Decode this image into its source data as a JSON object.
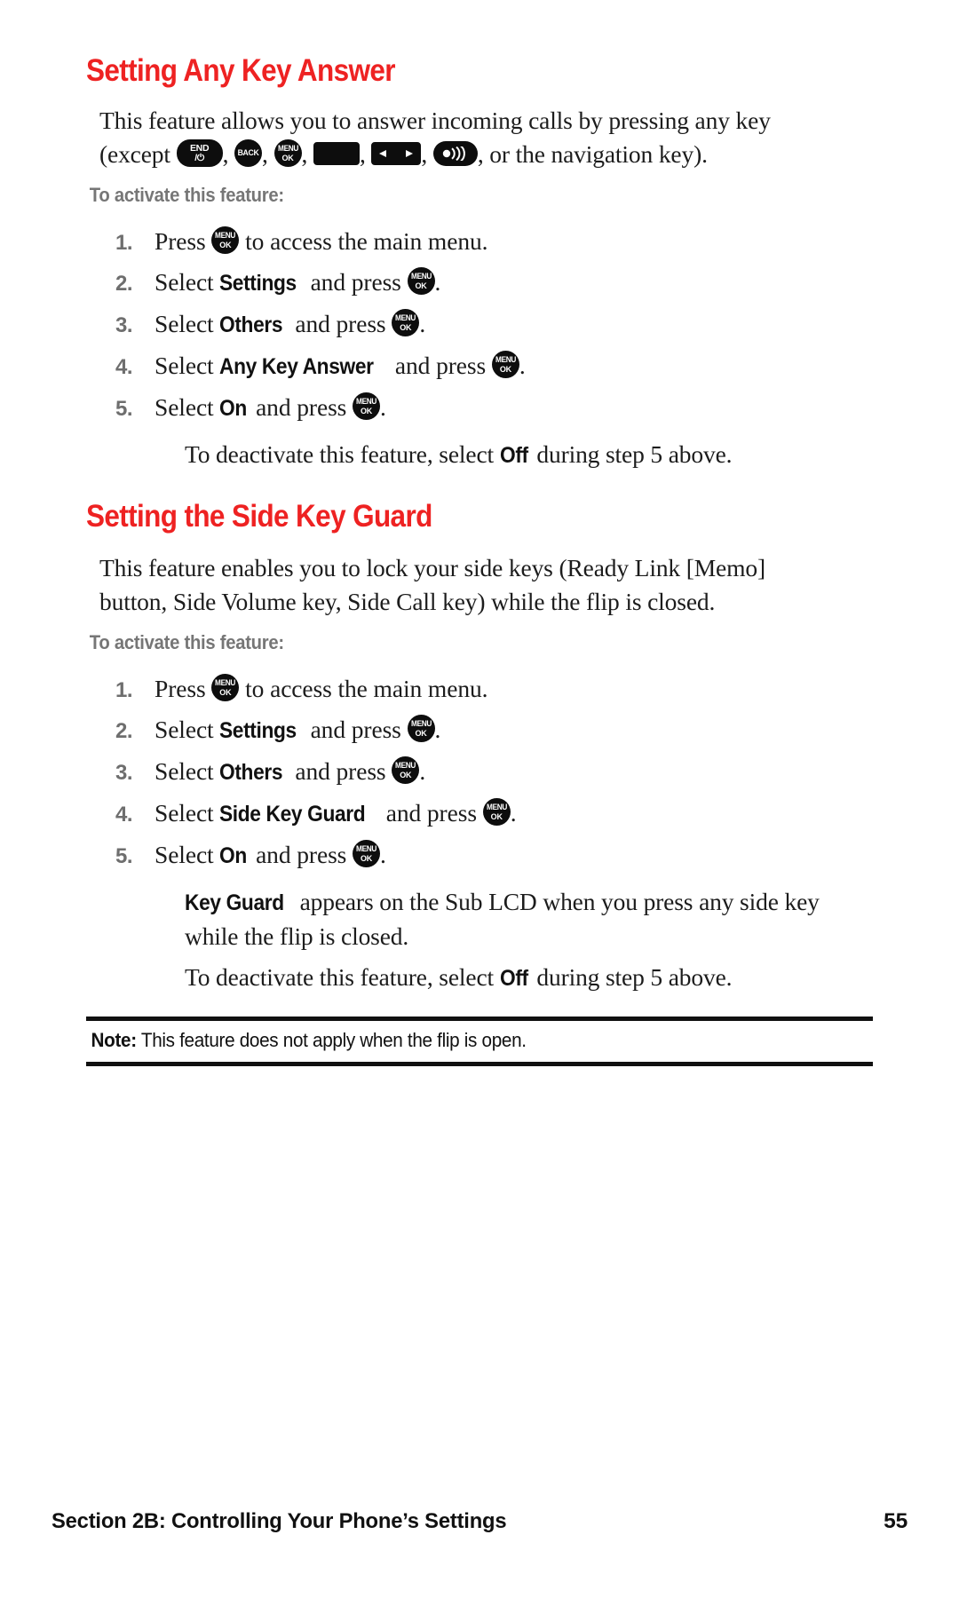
{
  "page": {
    "accent_color": "#ee2222",
    "number_color": "#6e6e6e",
    "label_color": "#767676"
  },
  "sections": [
    {
      "heading": "Setting Any Key Answer",
      "intro_line1": "This feature allows you to answer incoming calls by pressing any key",
      "intro_prefix": "(except ",
      "intro_suffix": ", or the navigation key).",
      "keys": [
        {
          "name": "end-power-key",
          "line1": "END",
          "line2": "/⏻"
        },
        {
          "name": "back-key",
          "line1": "BACK",
          "line2": ""
        },
        {
          "name": "menu-ok-key",
          "line1": "MENU",
          "line2": "OK"
        },
        {
          "name": "talk-key",
          "line1": "",
          "line2": ""
        },
        {
          "name": "side-volume-key",
          "line1": "",
          "line2": ""
        },
        {
          "name": "speaker-key",
          "line1": "",
          "line2": ""
        }
      ],
      "activate_label": "To activate this feature:",
      "steps": [
        {
          "num": "1.",
          "pre": "Press ",
          "term": "",
          "post": " to access the main menu.",
          "has_icon": true,
          "icon_pos": "mid"
        },
        {
          "num": "2.",
          "pre": "Select ",
          "term": "Settings",
          "post": " and press ",
          "has_icon": true,
          "icon_pos": "end"
        },
        {
          "num": "3.",
          "pre": "Select ",
          "term": "Others",
          "post": " and press ",
          "has_icon": true,
          "icon_pos": "end"
        },
        {
          "num": "4.",
          "pre": "Select ",
          "term": "Any Key Answer",
          "post": " and press ",
          "has_icon": true,
          "icon_pos": "end"
        },
        {
          "num": "5.",
          "pre": "Select ",
          "term": "On",
          "post": " and press ",
          "has_icon": true,
          "icon_pos": "end"
        }
      ],
      "notes": [
        {
          "pre": "To deactivate this feature, select ",
          "term": "Off",
          "post": " during step 5 above."
        }
      ]
    },
    {
      "heading": "Setting the Side Key Guard",
      "intro_line1": "This feature enables you to lock your side keys (Ready Link [Memo]",
      "intro_line2": "button, Side Volume key, Side Call key) while the flip is closed.",
      "activate_label": "To activate this feature:",
      "steps": [
        {
          "num": "1.",
          "pre": "Press ",
          "term": "",
          "post": " to access the main menu.",
          "has_icon": true,
          "icon_pos": "mid"
        },
        {
          "num": "2.",
          "pre": "Select ",
          "term": "Settings",
          "post": " and press ",
          "has_icon": true,
          "icon_pos": "end"
        },
        {
          "num": "3.",
          "pre": "Select ",
          "term": "Others",
          "post": " and press ",
          "has_icon": true,
          "icon_pos": "end"
        },
        {
          "num": "4.",
          "pre": "Select ",
          "term": "Side Key Guard",
          "post": " and press ",
          "has_icon": true,
          "icon_pos": "end"
        },
        {
          "num": "5.",
          "pre": "Select ",
          "term": "On",
          "post": " and press ",
          "has_icon": true,
          "icon_pos": "end"
        }
      ],
      "notes": [
        {
          "pre": "",
          "term": "Key Guard",
          "post": " appears on the Sub LCD when you press any side key while the flip is closed."
        },
        {
          "pre": "To deactivate this feature, select ",
          "term": "Off",
          "post": " during step 5 above."
        }
      ]
    }
  ],
  "note_block": {
    "label": "Note:",
    "text": " This feature does not apply when the flip is open."
  },
  "footer": {
    "left": "Section 2B: Controlling Your Phone’s Settings",
    "page_number": "55"
  }
}
